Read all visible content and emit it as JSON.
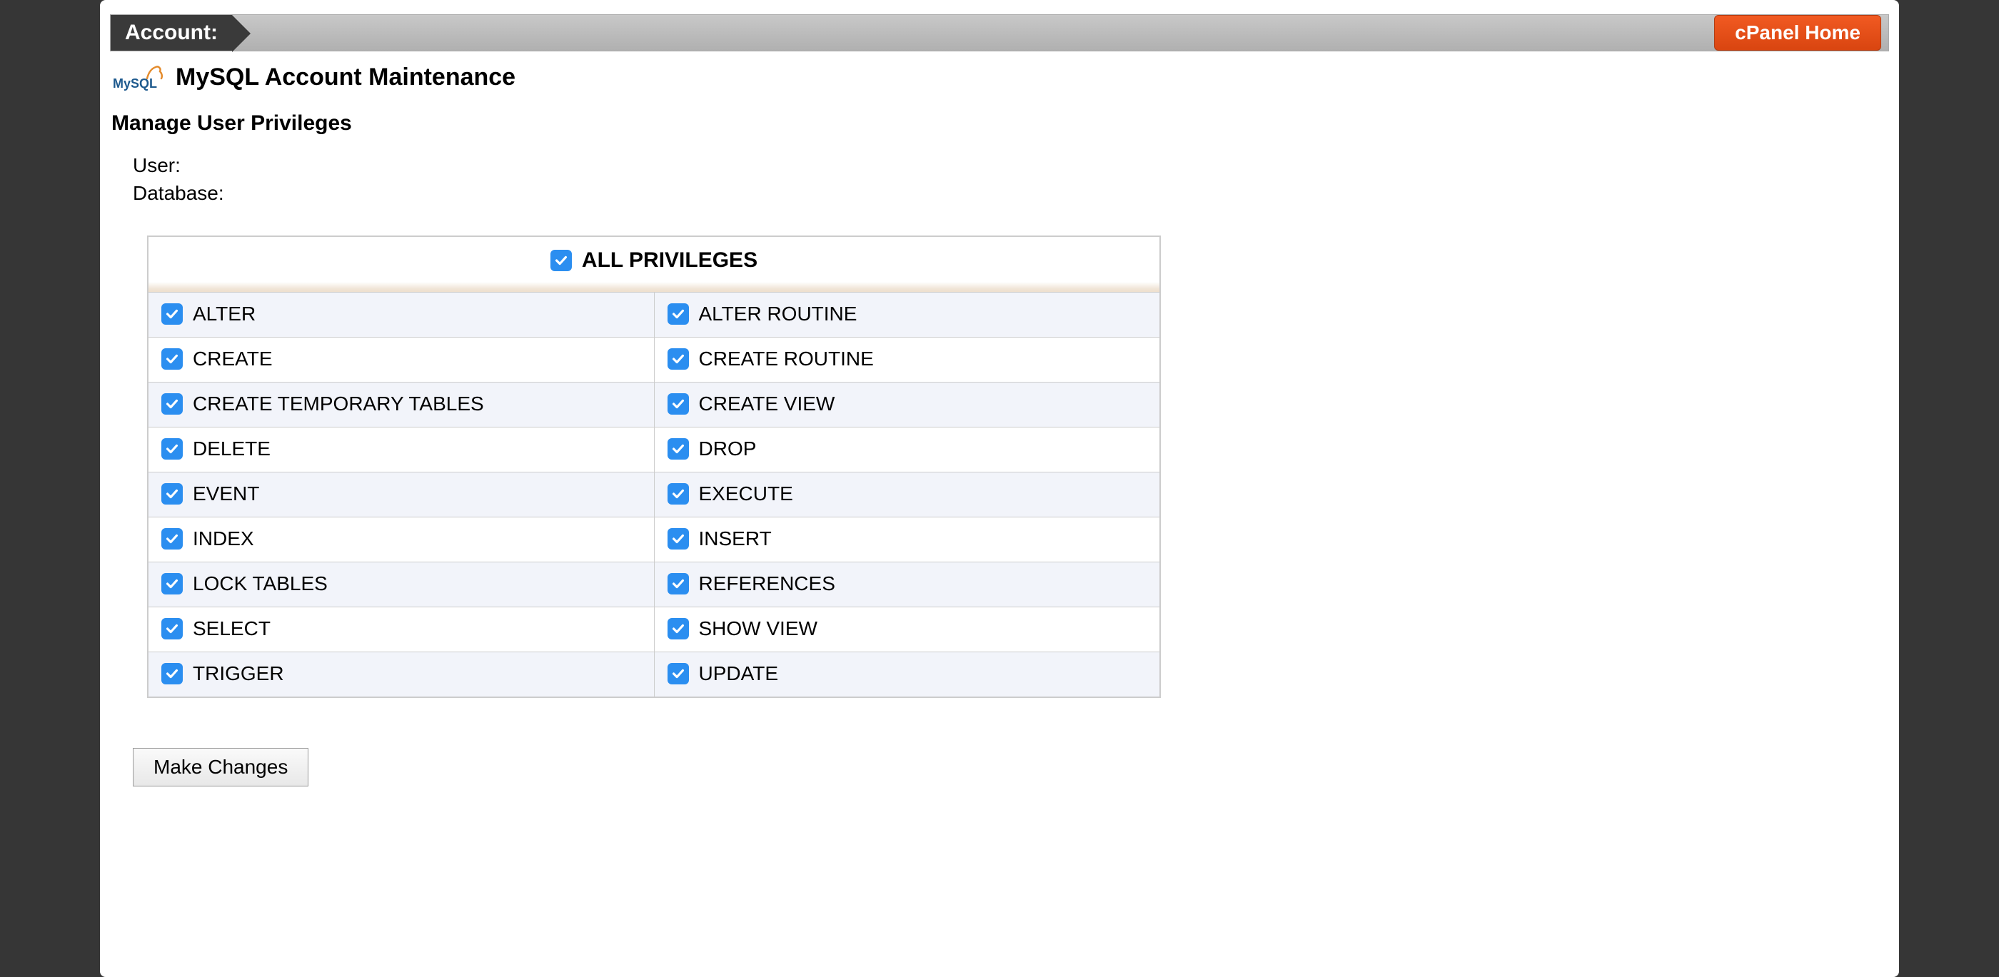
{
  "accountBar": {
    "label": "Account:",
    "homeButton": "cPanel Home"
  },
  "icon": {
    "name": "mysql-icon",
    "text": "MySQL"
  },
  "pageTitle": "MySQL Account Maintenance",
  "sectionTitle": "Manage User Privileges",
  "info": {
    "userLabel": "User:",
    "userValue": "",
    "databaseLabel": "Database:",
    "databaseValue": ""
  },
  "allPrivileges": {
    "label": "ALL PRIVILEGES",
    "checked": true
  },
  "privileges": [
    {
      "left": {
        "label": "ALTER",
        "checked": true
      },
      "right": {
        "label": "ALTER ROUTINE",
        "checked": true
      }
    },
    {
      "left": {
        "label": "CREATE",
        "checked": true
      },
      "right": {
        "label": "CREATE ROUTINE",
        "checked": true
      }
    },
    {
      "left": {
        "label": "CREATE TEMPORARY TABLES",
        "checked": true
      },
      "right": {
        "label": "CREATE VIEW",
        "checked": true
      }
    },
    {
      "left": {
        "label": "DELETE",
        "checked": true
      },
      "right": {
        "label": "DROP",
        "checked": true
      }
    },
    {
      "left": {
        "label": "EVENT",
        "checked": true
      },
      "right": {
        "label": "EXECUTE",
        "checked": true
      }
    },
    {
      "left": {
        "label": "INDEX",
        "checked": true
      },
      "right": {
        "label": "INSERT",
        "checked": true
      }
    },
    {
      "left": {
        "label": "LOCK TABLES",
        "checked": true
      },
      "right": {
        "label": "REFERENCES",
        "checked": true
      }
    },
    {
      "left": {
        "label": "SELECT",
        "checked": true
      },
      "right": {
        "label": "SHOW VIEW",
        "checked": true
      }
    },
    {
      "left": {
        "label": "TRIGGER",
        "checked": true
      },
      "right": {
        "label": "UPDATE",
        "checked": true
      }
    }
  ],
  "submitButton": "Make Changes"
}
